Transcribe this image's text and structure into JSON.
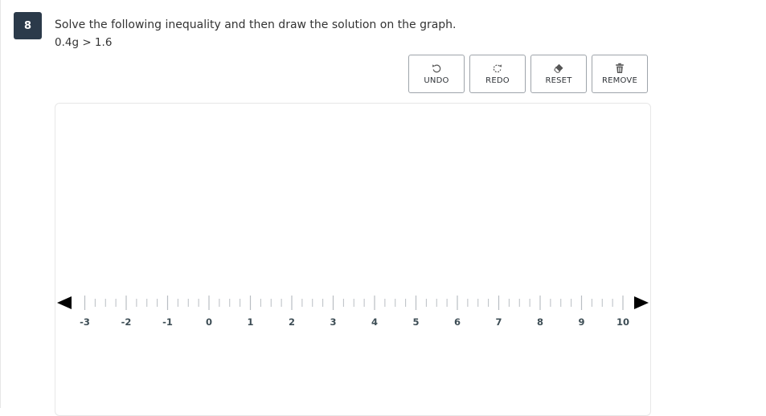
{
  "question": {
    "number": "8",
    "prompt": "Solve the following inequality and then draw the solution on the graph.",
    "expression": "0.4g > 1.6"
  },
  "toolbar": {
    "buttons": [
      {
        "label": "UNDO",
        "icon": "undo-icon"
      },
      {
        "label": "REDO",
        "icon": "redo-icon"
      },
      {
        "label": "RESET",
        "icon": "eraser-icon"
      },
      {
        "label": "REMOVE",
        "icon": "trash-icon"
      }
    ]
  },
  "number_line": {
    "min": -3,
    "max": 10,
    "step": 1,
    "minor_divisions": 4,
    "tick_labels": [
      "-3",
      "-2",
      "-1",
      "0",
      "1",
      "2",
      "3",
      "4",
      "5",
      "6",
      "7",
      "8",
      "9",
      "10"
    ],
    "arrow_color": "#000000",
    "tick_color": "#b9bec3",
    "label_color": "#3d4d55"
  }
}
